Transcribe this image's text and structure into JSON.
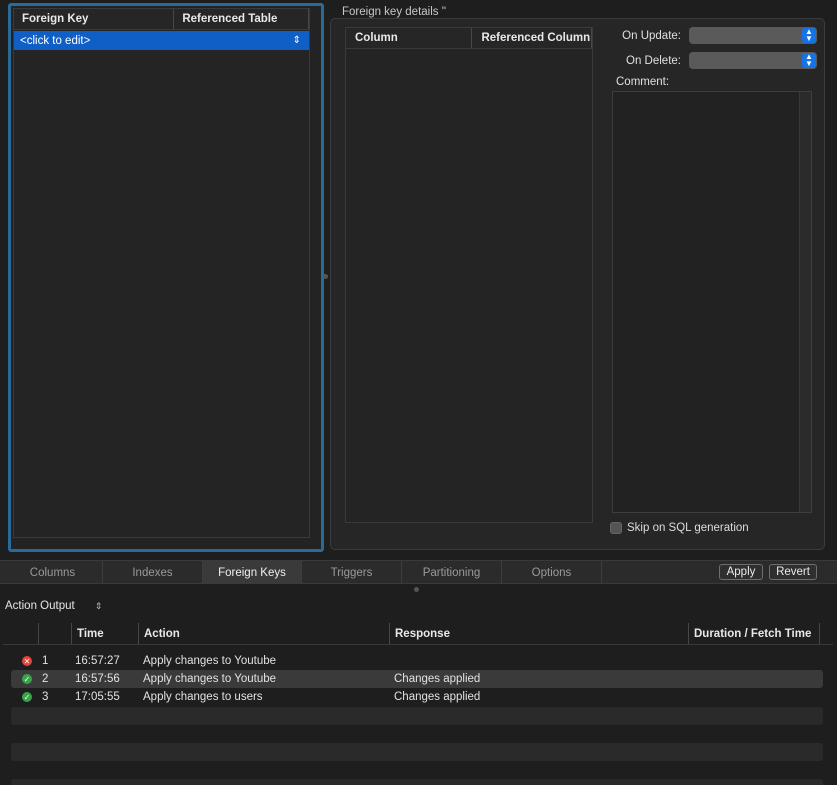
{
  "fk_list": {
    "columns": [
      "Foreign Key",
      "Referenced Table"
    ],
    "rows": [
      {
        "label": "<click to edit>"
      }
    ]
  },
  "details": {
    "title": "Foreign key details ''",
    "columns": [
      "Column",
      "Referenced Column"
    ],
    "on_update_label": "On Update:",
    "on_delete_label": "On Delete:",
    "comment_label": "Comment:",
    "skip_label": "Skip on SQL generation"
  },
  "tabs": [
    {
      "label": "Columns",
      "active": false
    },
    {
      "label": "Indexes",
      "active": false
    },
    {
      "label": "Foreign Keys",
      "active": true
    },
    {
      "label": "Triggers",
      "active": false
    },
    {
      "label": "Partitioning",
      "active": false
    },
    {
      "label": "Options",
      "active": false
    }
  ],
  "buttons": {
    "apply": "Apply",
    "revert": "Revert"
  },
  "output": {
    "selector_label": "Action Output",
    "columns": [
      "Time",
      "Action",
      "Response",
      "Duration / Fetch Time"
    ],
    "rows": [
      {
        "status": "error",
        "num": "1",
        "time": "16:57:27",
        "action": "Apply changes to Youtube",
        "response": ""
      },
      {
        "status": "ok",
        "num": "2",
        "time": "16:57:56",
        "action": "Apply changes to Youtube",
        "response": "Changes applied"
      },
      {
        "status": "ok",
        "num": "3",
        "time": "17:05:55",
        "action": "Apply changes to users",
        "response": "Changes applied"
      }
    ]
  },
  "colors": {
    "accent": "#1473e6",
    "selection": "#0f5fc7",
    "focus_ring": "#2a6a99",
    "ok": "#3aa34a",
    "error": "#e0443a"
  }
}
